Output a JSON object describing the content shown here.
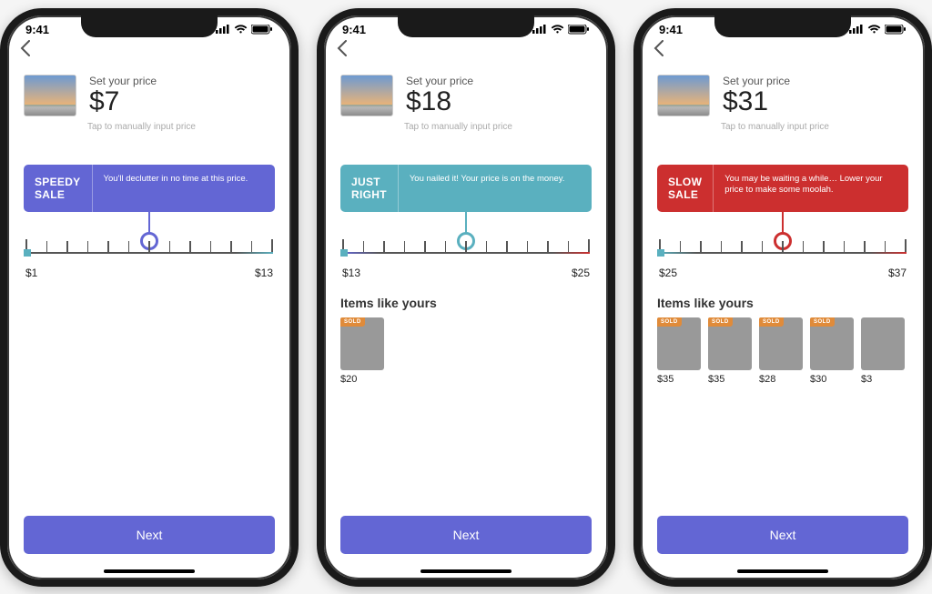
{
  "status_time": "9:41",
  "screens": [
    {
      "header": {
        "label": "Set your price",
        "price": "$7",
        "hint": "Tap to manually input price"
      },
      "bubble": {
        "variant": "speedy",
        "tag": "SPEEDY\nSALE",
        "msg": "You'll declutter in no time at this price."
      },
      "range": {
        "min": "$1",
        "max": "$13",
        "axis": "speedy"
      },
      "items_heading": "",
      "items": [],
      "next": "Next"
    },
    {
      "header": {
        "label": "Set your price",
        "price": "$18",
        "hint": "Tap to manually input price"
      },
      "bubble": {
        "variant": "just",
        "tag": "JUST\nRIGHT",
        "msg": "You nailed it! Your price is on the money."
      },
      "range": {
        "min": "$13",
        "max": "$25",
        "axis": "just"
      },
      "items_heading": "Items like yours",
      "items": [
        {
          "price": "$20",
          "sold": "SOLD",
          "pic": "p-phone"
        }
      ],
      "next": "Next"
    },
    {
      "header": {
        "label": "Set your price",
        "price": "$31",
        "hint": "Tap to manually input price"
      },
      "bubble": {
        "variant": "slow",
        "tag": "SLOW\nSALE",
        "msg": "You may be waiting a while… Lower your price to make some moolah."
      },
      "range": {
        "min": "$25",
        "max": "$37",
        "axis": "slow"
      },
      "items_heading": "Items like yours",
      "items": [
        {
          "price": "$35",
          "sold": "SOLD",
          "pic": "p-red"
        },
        {
          "price": "$35",
          "sold": "SOLD",
          "pic": "p-box"
        },
        {
          "price": "$28",
          "sold": "SOLD",
          "pic": "p-lap"
        },
        {
          "price": "$30",
          "sold": "SOLD",
          "pic": "p-key"
        },
        {
          "price": "$3",
          "sold": "",
          "pic": "p-edge"
        }
      ],
      "next": "Next"
    }
  ]
}
